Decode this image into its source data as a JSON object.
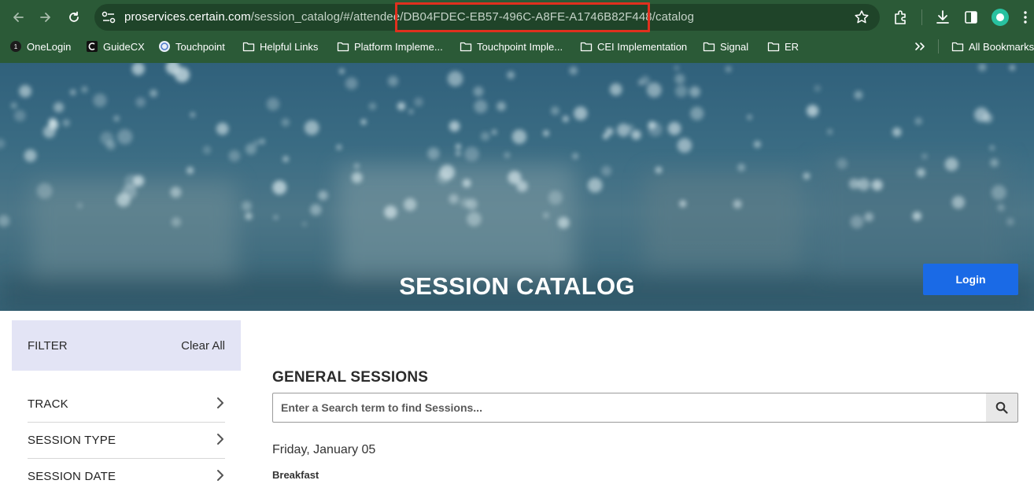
{
  "browser": {
    "url_host": "proservices.certain.com",
    "url_path_before": "/session_catalog/#/attendee",
    "url_highlighted": "/DB04FDEC-EB57-496C-A8FE-A1746B82F448/",
    "url_path_after": "catalog",
    "highlight_color": "#e0301e",
    "chrome_color": "#2b5a37"
  },
  "bookmarks": {
    "items": [
      {
        "label": "OneLogin",
        "icon": "onelogin-icon"
      },
      {
        "label": "GuideCX",
        "icon": "guidecx-icon"
      },
      {
        "label": "Touchpoint",
        "icon": "touchpoint-icon"
      },
      {
        "label": "Helpful Links",
        "icon": "folder-icon"
      },
      {
        "label": "Platform Impleme...",
        "icon": "folder-icon"
      },
      {
        "label": "Touchpoint Imple...",
        "icon": "folder-icon"
      },
      {
        "label": "CEI Implementation",
        "icon": "folder-icon"
      },
      {
        "label": "Signal",
        "icon": "folder-icon"
      },
      {
        "label": "ER",
        "icon": "folder-icon"
      }
    ],
    "all_bookmarks_label": "All Bookmarks"
  },
  "hero": {
    "title": "SESSION CATALOG",
    "login_label": "Login",
    "login_color": "#1a6ae6"
  },
  "sidebar": {
    "filter_label": "FILTER",
    "clear_all_label": "Clear All",
    "facets": [
      {
        "label": "TRACK"
      },
      {
        "label": "SESSION TYPE"
      },
      {
        "label": "SESSION DATE"
      }
    ]
  },
  "main": {
    "section_title": "GENERAL SESSIONS",
    "search_placeholder": "Enter a Search term to find Sessions...",
    "date_heading": "Friday, January 05",
    "first_session": "Breakfast"
  }
}
